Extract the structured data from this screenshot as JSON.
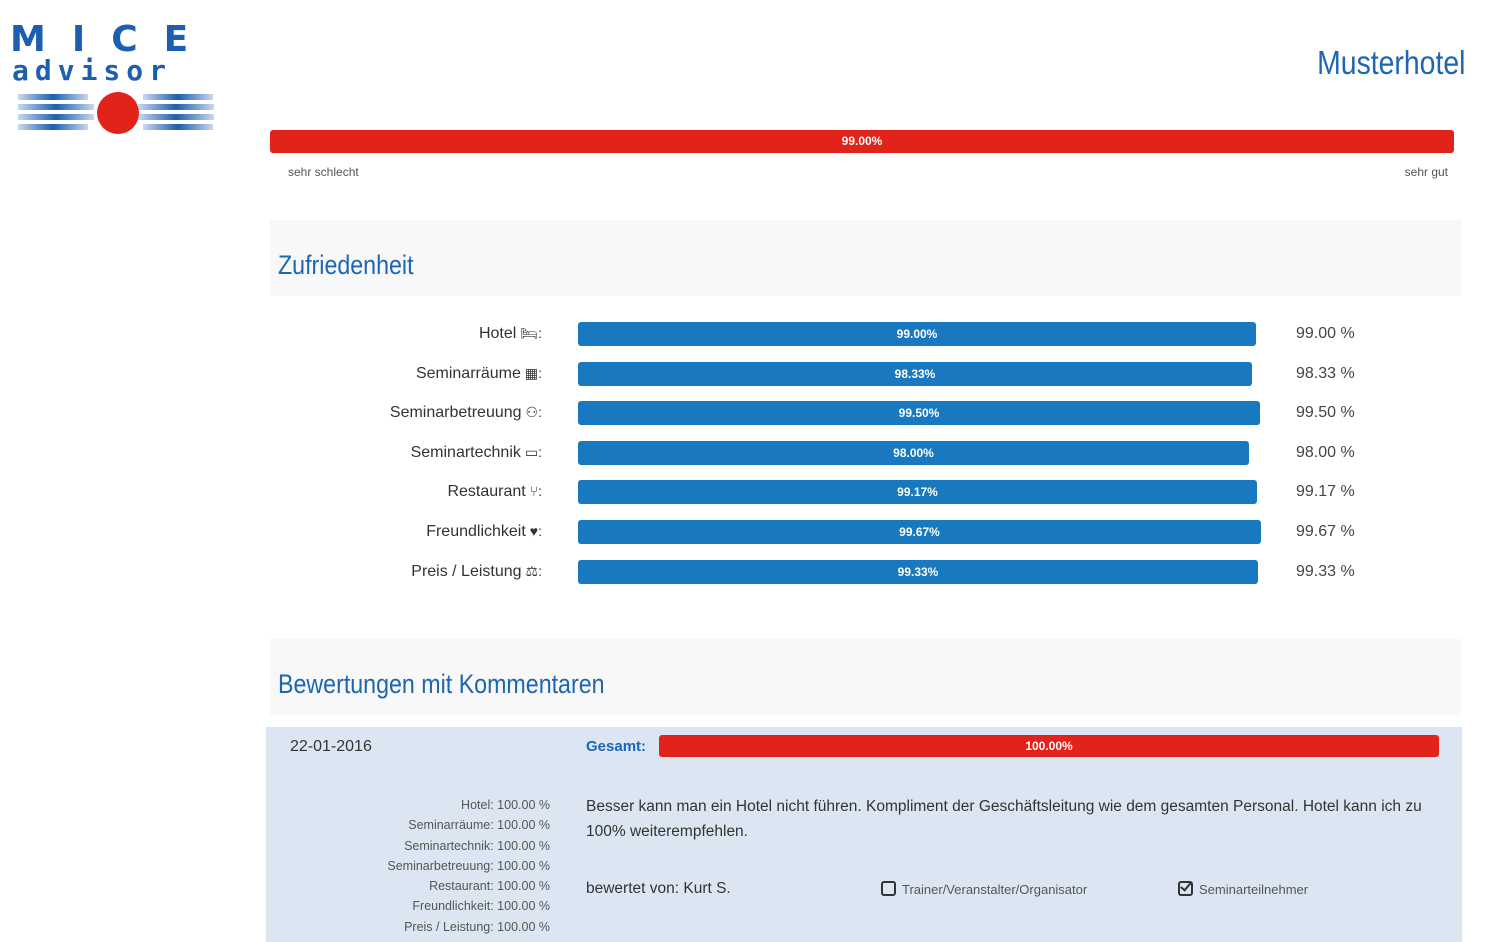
{
  "logo": {
    "line1": "MICE",
    "line2": "advisor"
  },
  "header": {
    "hotel_name": "Musterhotel"
  },
  "overall": {
    "percent_label": "99.00%",
    "value": 0.99,
    "scale_low": "sehr schlecht",
    "scale_high": "sehr gut"
  },
  "satisfaction": {
    "title": "Zufriedenheit",
    "items": [
      {
        "label": "Hotel",
        "icon": "bed-icon",
        "bar_label": "99.00%",
        "value_text": "99.00 %",
        "value": 99.0
      },
      {
        "label": "Seminarräume",
        "icon": "grid-icon",
        "bar_label": "98.33%",
        "value_text": "98.33 %",
        "value": 98.33
      },
      {
        "label": "Seminarbetreuung",
        "icon": "users-icon",
        "bar_label": "99.50%",
        "value_text": "99.50 %",
        "value": 99.5
      },
      {
        "label": "Seminartechnik",
        "icon": "laptop-icon",
        "bar_label": "98.00%",
        "value_text": "98.00 %",
        "value": 98.0
      },
      {
        "label": "Restaurant",
        "icon": "cutlery-icon",
        "bar_label": "99.17%",
        "value_text": "99.17 %",
        "value": 99.17
      },
      {
        "label": "Freundlichkeit",
        "icon": "heart-icon",
        "bar_label": "99.67%",
        "value_text": "99.67 %",
        "value": 99.67
      },
      {
        "label": "Preis / Leistung",
        "icon": "scale-icon",
        "bar_label": "99.33%",
        "value_text": "99.33 %",
        "value": 99.33
      }
    ]
  },
  "reviews": {
    "title": "Bewertungen mit Kommentaren",
    "items": [
      {
        "date": "22-01-2016",
        "total_label": "Gesamt:",
        "total_bar_label": "100.00%",
        "total_value": 1.0,
        "scores": [
          "Hotel: 100.00 %",
          "Seminarräume: 100.00 %",
          "Seminartechnik: 100.00 %",
          "Seminarbetreuung: 100.00 %",
          "Restaurant: 100.00 %",
          "Freundlichkeit: 100.00 %",
          "Preis / Leistung: 100.00 %"
        ],
        "comment": "Besser kann man ein Hotel nicht führen. Kompliment der Geschäftsleitung wie dem gesamten Personal. Hotel kann ich zu 100% weiterempfehlen.",
        "author": "bewertet von: Kurt S.",
        "role_organizer": "Trainer/Veranstalter/Organisator",
        "role_organizer_checked": false,
        "role_participant": "Seminarteilnehmer",
        "role_participant_checked": true
      }
    ]
  },
  "colors": {
    "brand_blue": "#1c66b3",
    "bar_blue": "#1878c0",
    "bar_red": "#e2231a",
    "card_bg": "#dce6f2"
  }
}
